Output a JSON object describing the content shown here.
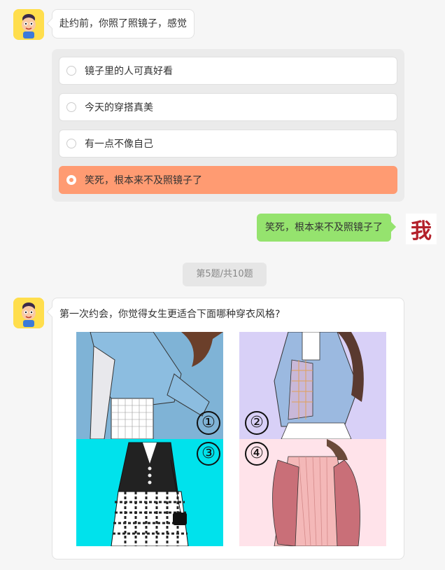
{
  "question1": {
    "prompt": "赴约前，你照了照镜子，感觉",
    "options": [
      {
        "label": "镜子里的人可真好看",
        "selected": false
      },
      {
        "label": "今天的穿搭真美",
        "selected": false
      },
      {
        "label": "有一点不像自己",
        "selected": false
      },
      {
        "label": "笑死，根本来不及照镜子了",
        "selected": true
      }
    ]
  },
  "reply": {
    "text": "笑死，根本来不及照镜子了",
    "avatar_char": "我"
  },
  "progress": {
    "label": "第5题/共10题"
  },
  "question2": {
    "prompt": "第一次约会，你觉得女生更适合下面哪种穿衣风格?",
    "numbers": [
      "①",
      "②",
      "③",
      "④"
    ]
  },
  "colors": {
    "selected_option": "#ff9b72",
    "reply_bubble": "#95e36e",
    "tile1_bg": "#7fb3d6",
    "tile2_bg": "#d8d0f7",
    "tile3_bg": "#00e2ec",
    "tile4_bg": "#ffe3ea"
  }
}
